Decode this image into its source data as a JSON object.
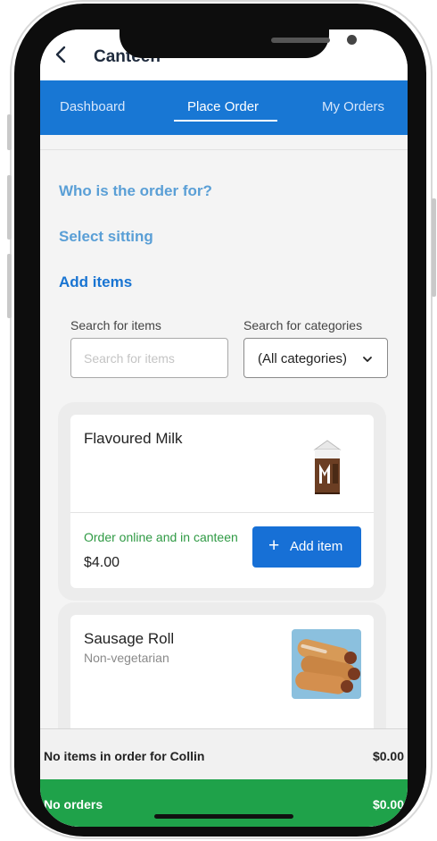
{
  "header": {
    "title": "Canteen"
  },
  "tabs": [
    {
      "label": "Dashboard",
      "active": false
    },
    {
      "label": "Place Order",
      "active": true
    },
    {
      "label": "My Orders",
      "active": false
    }
  ],
  "steps": {
    "who": "Who is the order for?",
    "sitting": "Select sitting",
    "add_items": "Add items"
  },
  "search": {
    "items_label": "Search for items",
    "items_placeholder": "Search for items",
    "categories_label": "Search for categories",
    "categories_value": "(All categories)"
  },
  "items": [
    {
      "name": "Flavoured Milk",
      "subtitle": "",
      "availability": "Order online and in canteen",
      "price": "$4.00",
      "add_label": "Add item",
      "image_icon": "chocolate-milk-carton"
    },
    {
      "name": "Sausage Roll",
      "subtitle": "Non-vegetarian",
      "availability": "",
      "price": "",
      "add_label": "",
      "image_icon": "sausage-roll-photo"
    }
  ],
  "footer": {
    "summary_text": "No items in order for Collin",
    "summary_total": "$0.00",
    "orders_text": "No orders",
    "orders_total": "$0.00"
  },
  "colors": {
    "primary": "#1877d4",
    "success": "#1fa24a",
    "step_link": "#5a9fd6"
  }
}
